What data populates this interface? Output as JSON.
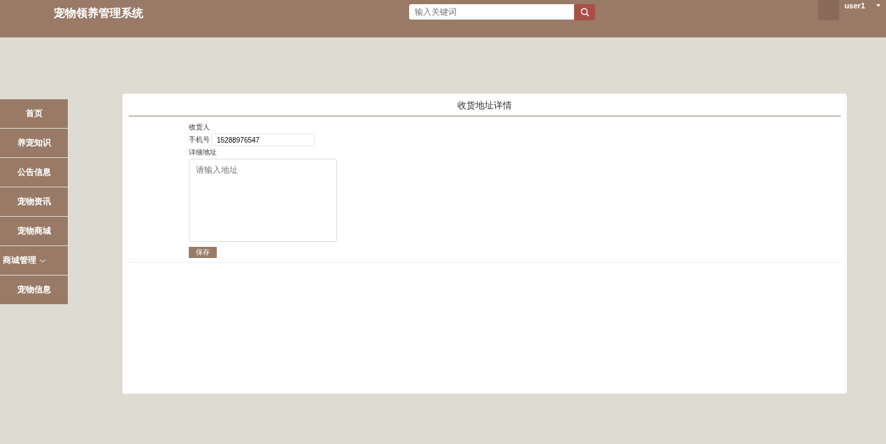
{
  "header": {
    "title": "宠物领养管理系统",
    "search": {
      "placeholder": "输入关键词"
    },
    "user": {
      "name": "user1"
    }
  },
  "sidebar": {
    "items": [
      {
        "label": "首页",
        "expandable": false
      },
      {
        "label": "养宠知识",
        "expandable": false
      },
      {
        "label": "公告信息",
        "expandable": false
      },
      {
        "label": "宠物资讯",
        "expandable": false
      },
      {
        "label": "宠物商城",
        "expandable": false
      },
      {
        "label": "商城管理",
        "expandable": true
      },
      {
        "label": "宠物信息",
        "expandable": false
      }
    ]
  },
  "card": {
    "title": "收货地址详情",
    "fields": [
      {
        "kind": "text",
        "label": "收货人"
      },
      {
        "kind": "input",
        "label": "手机号",
        "value": "15288976547"
      },
      {
        "kind": "textarea",
        "label": "详细地址",
        "placeholder": "请输入地址"
      }
    ],
    "save_button": "保存"
  }
}
